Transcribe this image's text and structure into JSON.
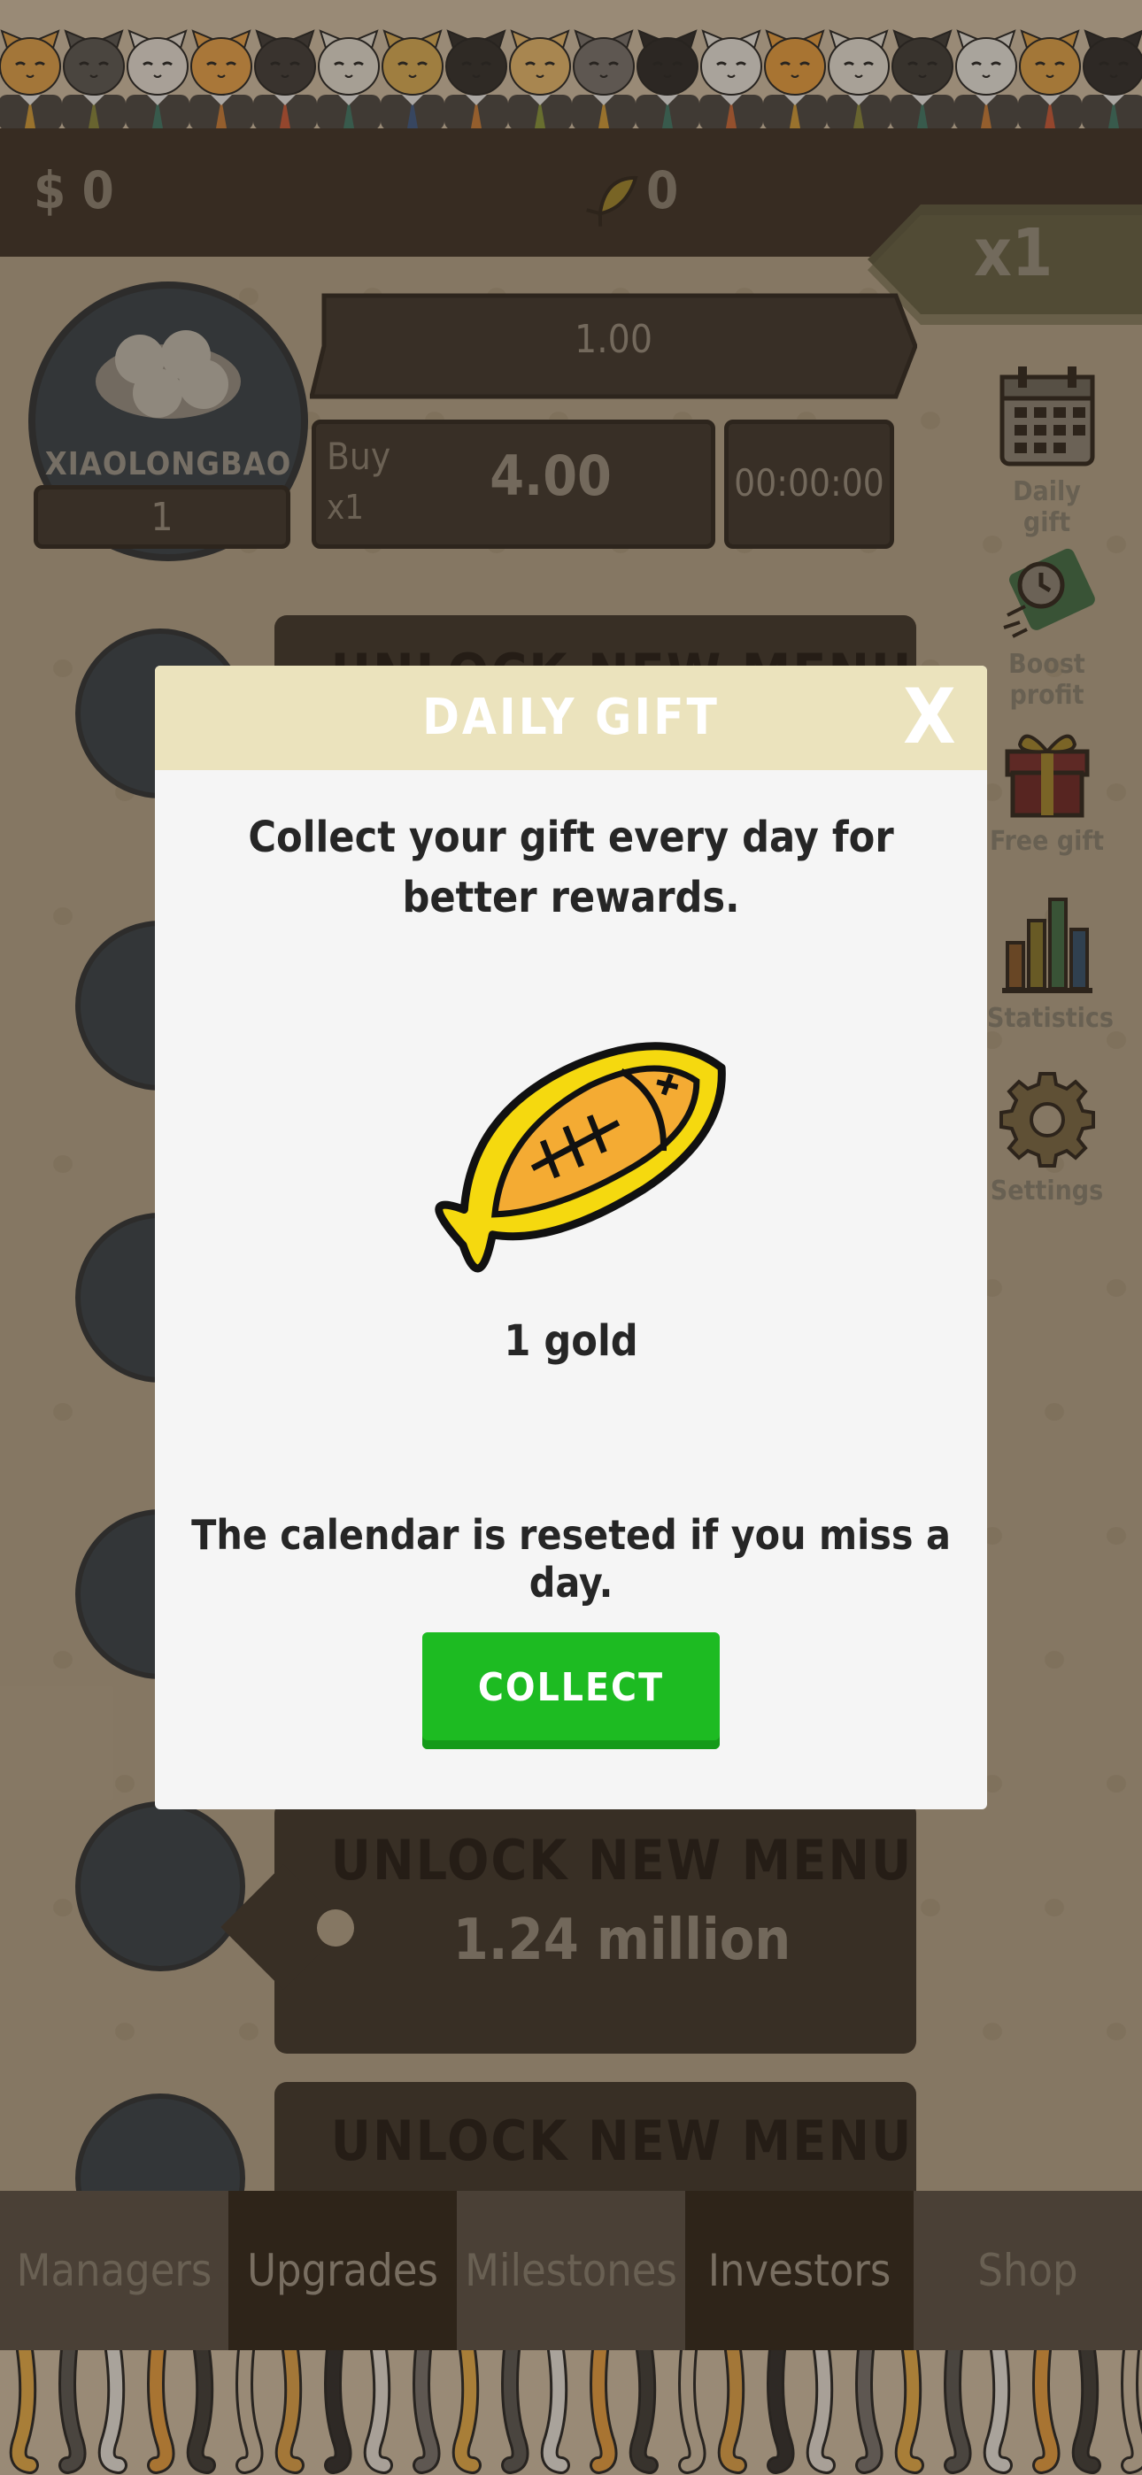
{
  "hud": {
    "money": "$ 0",
    "gold": "0",
    "multiplier": "x1"
  },
  "business": {
    "name": "XIAOLONGBAO",
    "level": "1",
    "profit": "1.00",
    "buy_label": "Buy",
    "buy_qty": "x1",
    "buy_price": "4.00",
    "timer": "00:00:00",
    "timer_progress": 0
  },
  "side_menu": [
    {
      "label": "Daily gift",
      "icon": "calendar-icon"
    },
    {
      "label": "Boost profit",
      "icon": "boost-icon"
    },
    {
      "label": "Free gift",
      "icon": "gift-icon"
    },
    {
      "label": "Statistics",
      "icon": "statistics-icon"
    },
    {
      "label": "Settings",
      "icon": "gear-icon"
    }
  ],
  "unlock_rows": [
    {
      "title": "UNLOCK NEW MENU",
      "price": ""
    },
    {
      "title": "UNLOCK NEW MENU",
      "price": "1.24 million"
    },
    {
      "title": "UNLOCK NEW MENU",
      "price": ""
    }
  ],
  "dialog": {
    "title": "DAILY GIFT",
    "close": "X",
    "description": "Collect your gift every day for better rewards.",
    "reward": "1 gold",
    "note": "The calendar is reseted if you miss a day.",
    "button": "COLLECT"
  },
  "tabs": [
    {
      "label": "Managers",
      "active": false
    },
    {
      "label": "Upgrades",
      "active": true
    },
    {
      "label": "Milestones",
      "active": false
    },
    {
      "label": "Investors",
      "active": true
    },
    {
      "label": "Shop",
      "active": false
    }
  ],
  "colors": {
    "accent_green": "#1dbb22",
    "dialog_header": "#ebe3bd",
    "fish_yellow": "#f5d90f",
    "fish_orange": "#f4ab33"
  }
}
